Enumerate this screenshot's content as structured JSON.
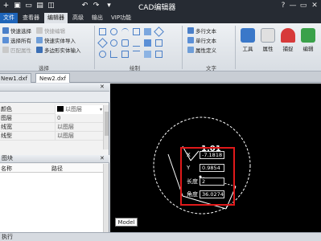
{
  "app": {
    "title": "CAD编辑器",
    "quick_access": [
      "+",
      "▣",
      "▭",
      "▤",
      "◫",
      "↶",
      "↷",
      "▾"
    ],
    "win": {
      "help": "?",
      "minimize": "—",
      "maximize": "▭",
      "close": "✕"
    }
  },
  "tabs": [
    "文件",
    "查看器",
    "编辑器",
    "高级",
    "输出",
    "VIP功能"
  ],
  "ribbon": {
    "select": {
      "label": "选择",
      "items": [
        "快速选择",
        "选择所有",
        "匹配属性",
        "快捷编辑",
        "快速实体导入",
        "多边形实体输入"
      ]
    },
    "draw": {
      "label": "绘制"
    },
    "text": {
      "label": "文字",
      "items": [
        "多行文本",
        "单行文本",
        "属性定义"
      ]
    },
    "big_buttons": [
      "工具",
      "属性",
      "捕捉",
      "编辑"
    ]
  },
  "doc_tabs": [
    "New1.dxf",
    "New2.dxf"
  ],
  "properties": {
    "rows": [
      {
        "name": "颜色",
        "value": "以图层"
      },
      {
        "name": "图层",
        "value": "0"
      },
      {
        "name": "线宽",
        "value": "以图层"
      },
      {
        "name": "线型",
        "value": "以图层"
      }
    ]
  },
  "layers": {
    "header": "图块",
    "col_name": "名称",
    "col_path": "路径"
  },
  "canvas": {
    "dim_text": "1.01",
    "x_label": "X",
    "x_value": "-7.1818",
    "y_label": "Y",
    "y_value": "0.9854",
    "len_label": "长度",
    "len_value": "2",
    "angle_label": "角度",
    "angle_value": "36.0274",
    "model_tab": "Model"
  },
  "status": {
    "text": "执行"
  }
}
